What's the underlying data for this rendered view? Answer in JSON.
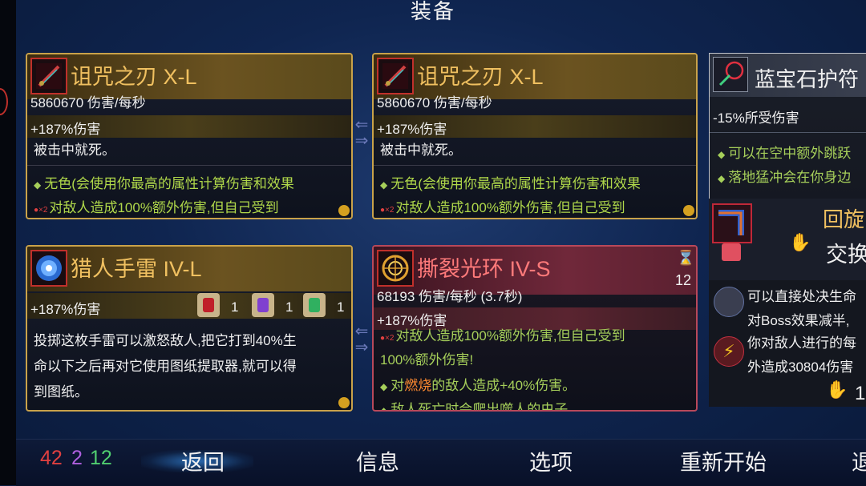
{
  "title": "装备",
  "colors": {
    "red": "#e04040",
    "purple": "#b060e0",
    "green": "#50d070",
    "gold": "#f0c060",
    "pink": "#ff7a7a",
    "lime": "#a6cf5a"
  },
  "card1": {
    "name": "诅咒之刃 X-L",
    "dps": "5860670 伤害/每秒",
    "stat": "+187%伤害",
    "desc": "被击中就死。",
    "aff1": "无色(会使用你最高的属性计算伤害和效果",
    "aff2": "对敌人造成100%额外伤害,但自己受到"
  },
  "card2": {
    "name": "诅咒之刃 X-L",
    "dps": "5860670 伤害/每秒",
    "stat": "+187%伤害",
    "desc": "被击中就死。",
    "aff1": "无色(会使用你最高的属性计算伤害和效果",
    "aff2": "对敌人造成100%额外伤害,但自己受到"
  },
  "card3": {
    "name": "猎人手雷 IV-L",
    "stat": "+187%伤害",
    "scroll_counts": [
      "1",
      "1",
      "1"
    ],
    "desc_lines": [
      "投掷这枚手雷可以激怒敌人,把它打到40%生",
      "命以下之后再对它使用图纸提取器,就可以得",
      "到图纸。"
    ]
  },
  "card4": {
    "name": "撕裂光环 IV-S",
    "cooldown": "12",
    "dps": "68193 伤害/每秒 (3.7秒)",
    "stat": "+187%伤害",
    "aff1_line1": "对敌人造成100%额外伤害,但自己受到",
    "aff1_line2": "100%额外伤害!",
    "aff2_pre": "对",
    "aff2_hl": "燃烧",
    "aff2_post": "的敌人造成+40%伤害。",
    "aff3": "敌人死亡时会爬出噬人的虫子"
  },
  "right_panel": {
    "name": "蓝宝石护符",
    "stat": "-15%所受伤害",
    "aff1": "可以在空中额外跳跃",
    "aff2": "落地猛冲会在你身边",
    "skill_label": "回旋",
    "swap_label": "交换",
    "mut1_line1": "可以直接处决生命",
    "mut1_line2": "对Boss效果减半,",
    "mut2_line1": "你对敌人进行的每",
    "mut2_line2": "外造成30804伤害",
    "bottom_count": "1"
  },
  "footer": {
    "stat_red": "42",
    "stat_purple": "2",
    "stat_green": "12",
    "back": "返回",
    "info": "信息",
    "options": "选项",
    "restart": "重新开始",
    "more": "退"
  }
}
